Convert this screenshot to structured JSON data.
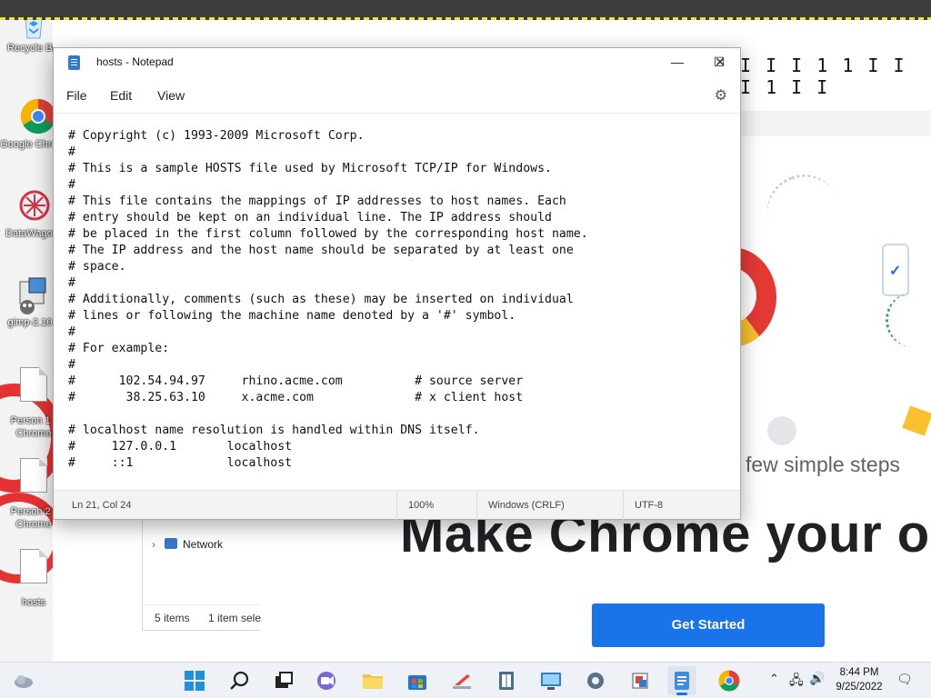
{
  "desktop": {
    "icons": [
      {
        "label": "Recycle Bin",
        "name": "recycle-bin-icon"
      },
      {
        "label": "Google Chrome",
        "name": "google-chrome-shortcut-icon"
      },
      {
        "label": "DataWagon",
        "name": "datawagon-shortcut-icon"
      },
      {
        "label": "gimp-2.10",
        "name": "gimp-shortcut-icon"
      },
      {
        "label": "Person 1 - Chrome",
        "name": "person1-chrome-shortcut-icon"
      },
      {
        "label": "Person 2 - Chrome",
        "name": "person2-chrome-shortcut-icon"
      },
      {
        "label": "hosts",
        "name": "hosts-file-icon"
      }
    ]
  },
  "background_page": {
    "barcode_text": "I I I 1 1 I I I 1 I I",
    "tagline": "few simple steps",
    "headline": "Make Chrome your o",
    "cta_label": "Get Started",
    "accent": "#1a73e8"
  },
  "explorer": {
    "nav_item": "Network",
    "item_count": "5 items",
    "selection": "1 item sele"
  },
  "notepad": {
    "title": "hosts - Notepad",
    "menu": {
      "file": "File",
      "edit": "Edit",
      "view": "View"
    },
    "lines": [
      "# Copyright (c) 1993-2009 Microsoft Corp.",
      "#",
      "# This is a sample HOSTS file used by Microsoft TCP/IP for Windows.",
      "#",
      "# This file contains the mappings of IP addresses to host names. Each",
      "# entry should be kept on an individual line. The IP address should",
      "# be placed in the first column followed by the corresponding host name.",
      "# The IP address and the host name should be separated by at least one",
      "# space.",
      "#",
      "# Additionally, comments (such as these) may be inserted on individual",
      "# lines or following the machine name denoted by a '#' symbol.",
      "#",
      "# For example:",
      "#",
      "#      102.54.94.97     rhino.acme.com          # source server",
      "#       38.25.63.10     x.acme.com              # x client host",
      "",
      "# localhost name resolution is handled within DNS itself.",
      "#     127.0.0.1       localhost",
      "#     ::1             localhost"
    ],
    "status": {
      "position": "Ln 21, Col 24",
      "zoom": "100%",
      "line_ending": "Windows (CRLF)",
      "encoding": "UTF-8"
    }
  },
  "taskbar": {
    "time": "8:44 PM",
    "date": "9/25/2022"
  }
}
